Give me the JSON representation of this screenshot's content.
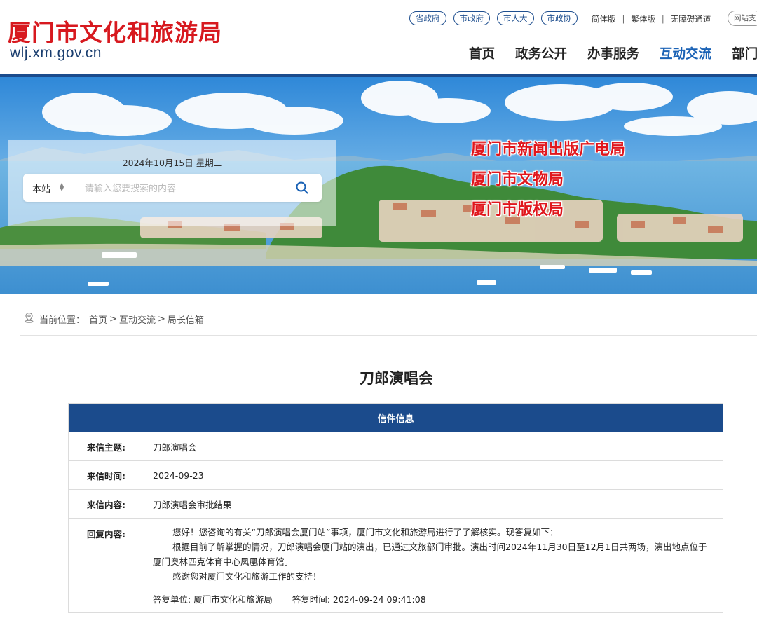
{
  "header": {
    "site_title": "厦门市文化和旅游局",
    "site_url": "wlj.xm.gov.cn",
    "gov_links": [
      "省政府",
      "市政府",
      "市人大",
      "市政协"
    ],
    "util_links": [
      "简体版",
      "繁体版",
      "无障碍通道"
    ],
    "site_group": "网站支",
    "nav": [
      "首页",
      "政务公开",
      "办事服务",
      "互动交流",
      "部门"
    ],
    "active_nav": "互动交流"
  },
  "banner": {
    "date": "2024年10月15日 星期二",
    "search": {
      "scope": "本站",
      "placeholder": "请输入您要搜索的内容"
    },
    "agencies": [
      "厦门市新闻出版广电局",
      "厦门市文物局",
      "厦门市版权局"
    ]
  },
  "breadcrumb": {
    "prefix": "当前位置：",
    "items": [
      "首页",
      "互动交流",
      "局长信箱"
    ]
  },
  "letter": {
    "title": "刀郎演唱会",
    "section_header": "信件信息",
    "rows": [
      {
        "label": "来信主题:",
        "value": "刀郎演唱会"
      },
      {
        "label": "来信时间:",
        "value": "2024-09-23"
      },
      {
        "label": "来信内容:",
        "value": "刀郎演唱会审批结果"
      }
    ],
    "reply": {
      "label": "回复内容:",
      "paragraphs": [
        "您好！您咨询的有关“刀郎演唱会厦门站”事项，厦门市文化和旅游局进行了了解核实。现答复如下：",
        "根据目前了解掌握的情况，刀郎演唱会厦门站的演出，已通过文旅部门审批。演出时间2024年11月30日至12月1日共两场，演出地点位于厦门奥林匹克体育中心凤凰体育馆。",
        "感谢您对厦门文化和旅游工作的支持！"
      ],
      "unit_label": "答复单位:",
      "unit": "厦门市文化和旅游局",
      "time_label": "答复时间:",
      "time": "2024-09-24 09:41:08"
    }
  },
  "colors": {
    "brand_red": "#d7191f",
    "nav_blue": "#1a62b5",
    "bar_blue": "#1b4b8c"
  }
}
